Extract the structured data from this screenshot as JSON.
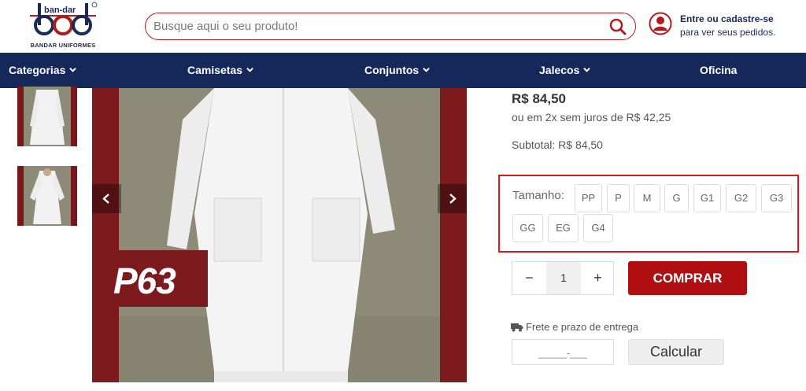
{
  "header": {
    "logo_text": "ban-dar",
    "brand_name": "BANDAR UNIFORMES",
    "search_placeholder": "Busque aqui o seu produto!",
    "account_line1": "Entre ou cadastre-se",
    "account_line2": "para ver seus pedidos."
  },
  "nav": {
    "items": [
      {
        "label": "Categorias",
        "has_dropdown": true
      },
      {
        "label": "Camisetas",
        "has_dropdown": true
      },
      {
        "label": "Conjuntos",
        "has_dropdown": true
      },
      {
        "label": "Jalecos",
        "has_dropdown": true
      },
      {
        "label": "Oficina",
        "has_dropdown": false
      }
    ]
  },
  "gallery": {
    "badge_text": "P63"
  },
  "product": {
    "price": "R$ 84,50",
    "installments": "ou em 2x sem juros de R$ 42,25",
    "subtotal": "Subtotal: R$ 84,50",
    "size_label": "Tamanho:",
    "sizes": [
      "PP",
      "P",
      "M",
      "G",
      "G1",
      "G2",
      "G3",
      "GG",
      "EG",
      "G4"
    ],
    "quantity": "1",
    "minus_label": "−",
    "plus_label": "+",
    "buy_label": "COMPRAR"
  },
  "shipping": {
    "label": "Frete e prazo de entrega",
    "cep_placeholder": "_____-___",
    "calc_label": "Calcular"
  },
  "colors": {
    "brand_red": "#b00f12",
    "highlight_red": "#e0161b",
    "nav_blue": "#14285a"
  }
}
